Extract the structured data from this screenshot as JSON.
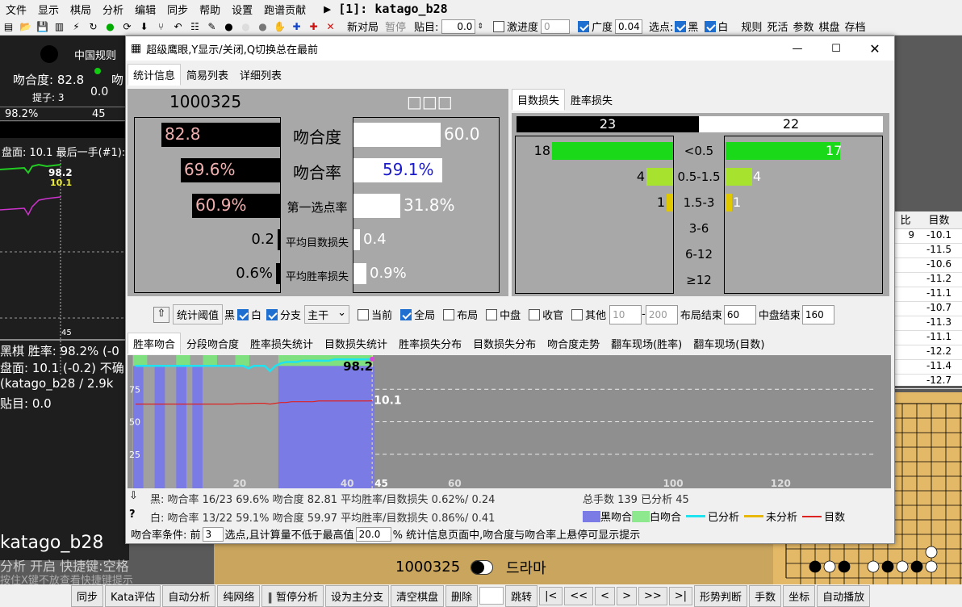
{
  "menu": {
    "items": [
      "文件",
      "显示",
      "棋局",
      "分析",
      "编辑",
      "同步",
      "帮助",
      "设置",
      "跑谱贡献"
    ],
    "title": "▶ [1]: katago_b28"
  },
  "toolbar": {
    "new_game": "新对局",
    "pause": "暂停",
    "komi_label": "贴目:",
    "komi_value": "0.0",
    "progress_label": "激进度",
    "progress_value": "0",
    "breadth_label": "广度",
    "breadth_value": "0.04",
    "pick_label": "选点:",
    "black": "黑",
    "white": "白",
    "rules": "规则",
    "deadstones": "死活",
    "params": "参数",
    "board": "棋盘",
    "save": "存档"
  },
  "left": {
    "rules": "中国规则",
    "match_label": "吻合度: 82.8",
    "match2": "吻",
    "captures": "提子: 3",
    "captures_val": "0.0",
    "winrate": "98.2%",
    "winrate2": "45",
    "score_line": "盘面: 10.1 最后一手(#1):",
    "graph_top": "98.2",
    "graph_score": "10.1",
    "graph_tick": "45",
    "status1": "黑棋 胜率: 98.2% (-0",
    "status2": "盘面: 10.1 (-0.2) 不确",
    "status3": "(katago_b28 / 2.9k",
    "status4": "贴目: 0.0",
    "engine": "katago_b28",
    "mode": "分析 开启  快捷键:空格",
    "hint": "按住X键不放查看快捷键提示"
  },
  "dialog": {
    "title": "超级鹰眼,Y显示/关闭,Q切换总在最前",
    "tabs": [
      "统计信息",
      "简易列表",
      "详细列表"
    ],
    "black_name": "1000325",
    "white_name": "□□□",
    "rows": [
      {
        "label": "吻合度",
        "b": "82.8",
        "w": "60.0"
      },
      {
        "label": "吻合率",
        "b": "69.6%",
        "w": "59.1%"
      },
      {
        "label": "第一选点率",
        "b": "60.9%",
        "w": "31.8%"
      },
      {
        "label": "平均目数损失",
        "b": "0.2",
        "w": "0.4"
      },
      {
        "label": "平均胜率损失",
        "b": "0.6%",
        "w": "0.9%"
      }
    ],
    "loss_tabs": [
      "目数损失",
      "胜率损失"
    ],
    "loss_black_total": "23",
    "loss_white_total": "22",
    "buckets": [
      {
        "label": "<0.5",
        "b": "18",
        "w": "17",
        "bv": 18,
        "wv": 17
      },
      {
        "label": "0.5-1.5",
        "b": "4",
        "w": "4",
        "bv": 4,
        "wv": 4
      },
      {
        "label": "1.5-3",
        "b": "1",
        "w": "1",
        "bv": 1,
        "wv": 1
      },
      {
        "label": "3-6",
        "b": "",
        "w": "",
        "bv": 0,
        "wv": 0
      },
      {
        "label": "6-12",
        "b": "",
        "w": "",
        "bv": 0,
        "wv": 0
      },
      {
        "label": "≥12",
        "b": "",
        "w": "",
        "bv": 0,
        "wv": 0
      }
    ],
    "filter": {
      "threshold": "统计阈值",
      "black": "黑",
      "white": "白",
      "branch": "分支",
      "branch_sel": "主干",
      "current": "当前",
      "all": "全局",
      "opening": "布局",
      "middle": "中盘",
      "endgame": "收官",
      "other": "其他",
      "from": "10",
      "to": "200",
      "opening_end_label": "布局结束",
      "opening_end": "60",
      "middle_end_label": "中盘结束",
      "middle_end": "160"
    },
    "chart_tabs": [
      "胜率吻合",
      "分段吻合度",
      "胜率损失统计",
      "目数损失统计",
      "胜率损失分布",
      "目数损失分布",
      "吻合度走势",
      "翻车现场(胜率)",
      "翻车现场(目数)"
    ],
    "summary1": "黑: 吻合率 16/23 69.6% 吻合度 82.81 平均胜率/目数损失 0.62%/ 0.24",
    "summary2": "白: 吻合率 13/22 59.1% 吻合度 59.97 平均胜率/目数损失 0.86%/ 0.41",
    "total": "总手数 139 已分析 45",
    "legend": [
      "黑吻合",
      "白吻合",
      "已分析",
      "未分析",
      "目数"
    ],
    "cond_label": "吻合率条件: 前",
    "cond_n": "3",
    "cond_mid": "选点,且计算量不低于最高值",
    "cond_pct": "20.0",
    "cond_tail": "%   统计信息页面中,吻合度与吻合率上悬停可显示提示"
  },
  "right": {
    "col1": "比",
    "col2": "目数",
    "cells": [
      "-10.1",
      "-11.5",
      "-10.6",
      "-11.2",
      "-11.1",
      "-10.7",
      "-11.3",
      "-11.1",
      "-12.2",
      "-11.4",
      "-12.7"
    ],
    "c1": [
      "9",
      "",
      "",
      "",
      "",
      "",
      "",
      "",
      "",
      "",
      ""
    ]
  },
  "board_caption": "1000325",
  "board_caption2": "드라마",
  "buttons": [
    "同步",
    "Kata评估",
    "自动分析",
    "纯网络",
    "‖ 暂停分析",
    "设为主分支",
    "清空棋盘",
    "删除",
    "",
    "跳转",
    "|<",
    "<<",
    "<",
    ">",
    ">>",
    ">|",
    "形势判断",
    "手数",
    "坐标",
    "自动播放"
  ],
  "chart_data": {
    "type": "line",
    "x": [
      1,
      2,
      3,
      4,
      5,
      6,
      7,
      8,
      9,
      10,
      11,
      12,
      13,
      14,
      15,
      16,
      17,
      18,
      19,
      20,
      21,
      22,
      23,
      24,
      25,
      26,
      27,
      28,
      29,
      30,
      31,
      32,
      33,
      34,
      35,
      36,
      37,
      38,
      39,
      40,
      41,
      42,
      43,
      44,
      45
    ],
    "series": [
      {
        "name": "已分析",
        "values": [
          93,
          93,
          93,
          93,
          93,
          93,
          93,
          93,
          93,
          93,
          93,
          93,
          93,
          93,
          93,
          93,
          93,
          93,
          93,
          93,
          93,
          91,
          93,
          93,
          93,
          89,
          93,
          95,
          96,
          96,
          96,
          97,
          97,
          97,
          97,
          97,
          97,
          98,
          98,
          98,
          98,
          98,
          98,
          98,
          98.2
        ]
      },
      {
        "name": "目数",
        "values": [
          6,
          6,
          6,
          6,
          6,
          6,
          6,
          6,
          6,
          6,
          6,
          6,
          6,
          6,
          6,
          6,
          6,
          6,
          6,
          6.5,
          6.5,
          6.5,
          7,
          7,
          7,
          6,
          7,
          8,
          8,
          9,
          9,
          9,
          9,
          9,
          10,
          10,
          10,
          10,
          10,
          10,
          10,
          10,
          10,
          10,
          10.1
        ]
      }
    ],
    "yticks": [
      25,
      50,
      75
    ],
    "xticks": [
      20,
      40,
      45,
      60,
      100,
      120
    ],
    "xlim": [
      1,
      140
    ],
    "ylim": [
      0,
      100
    ],
    "end_label_wr": "98.2",
    "end_label_score": "10.1"
  }
}
